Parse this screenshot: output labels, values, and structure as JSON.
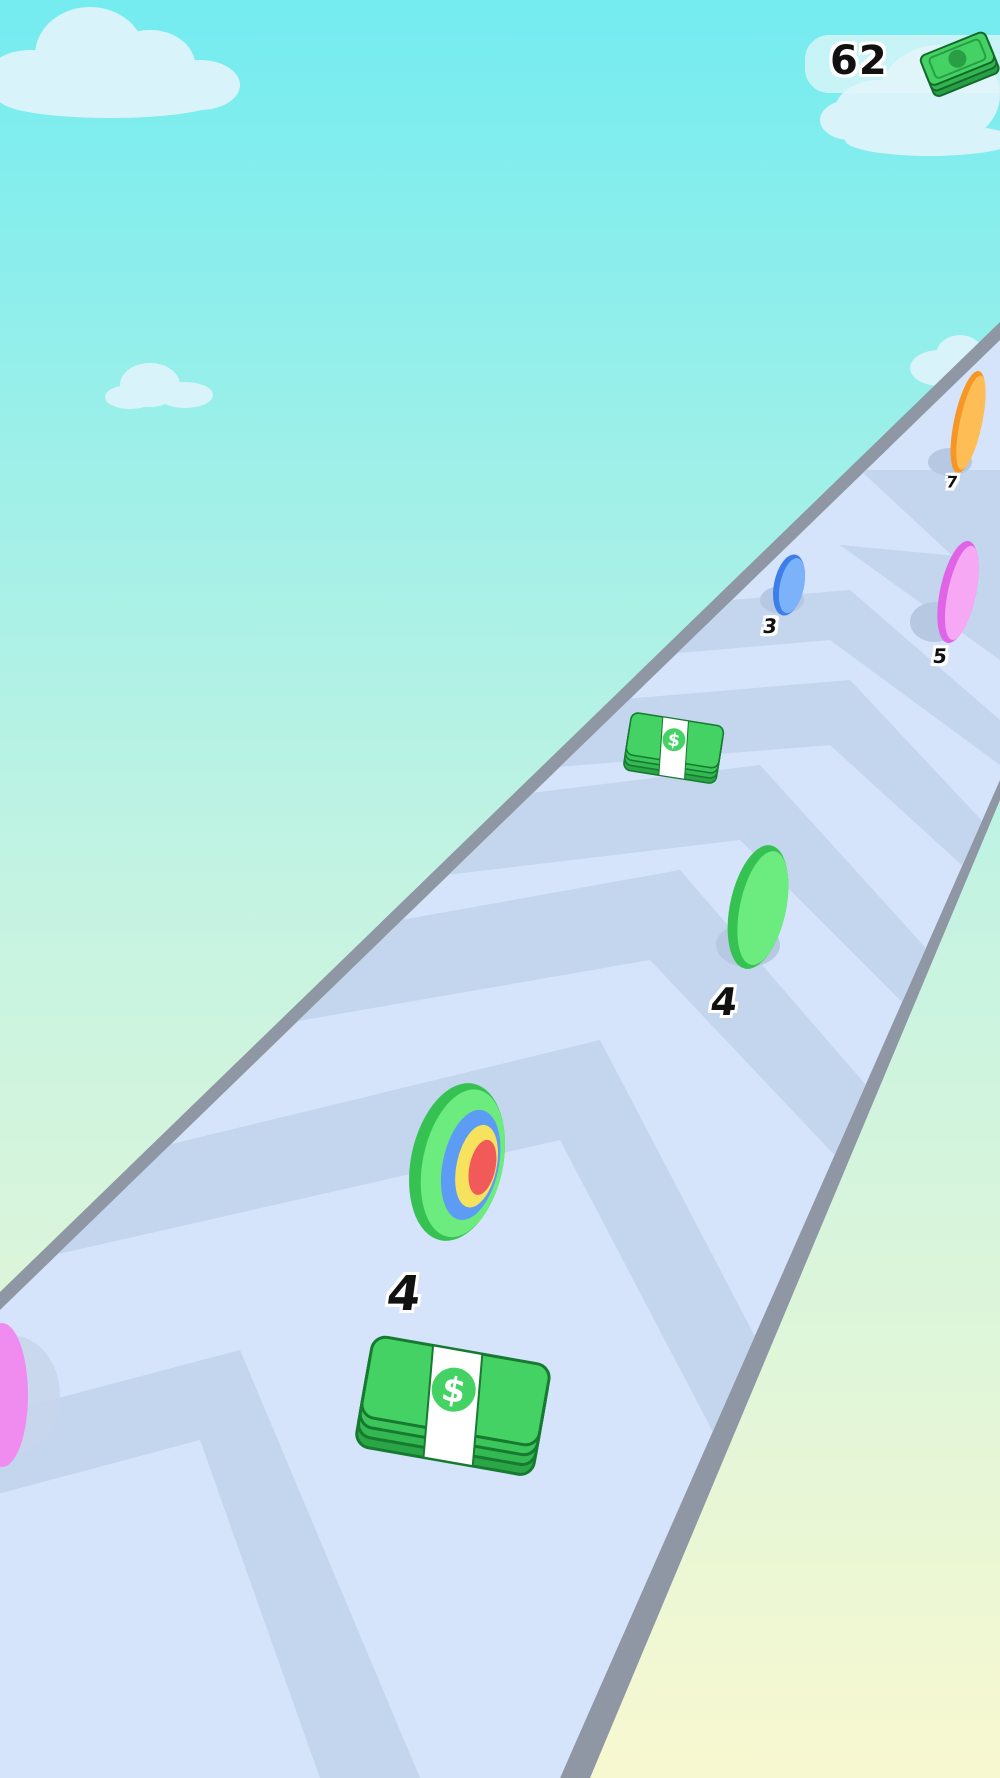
{
  "hud": {
    "money": "62",
    "money_icon": "cash-stack-icon"
  },
  "track": {
    "labels": {
      "rings_stack": "4",
      "green_ring": "4",
      "blue_ring": "3",
      "pink_ring": "5",
      "orange_ring": "7"
    }
  },
  "colors": {
    "sky_top": "#74ECF0",
    "sky_bottom": "#F8F8D0",
    "road_light": "#D5E3FB",
    "road_dark": "#C4D5EE",
    "rail": "#8E97A3",
    "cash_green": "#3FCE5C",
    "ring_green": "#5EE870",
    "ring_blue": "#5D9CF5",
    "ring_pink": "#F08CF0",
    "ring_orange": "#FFAA33",
    "ring_red": "#F25A5A",
    "ring_yellow": "#F6E25C"
  }
}
